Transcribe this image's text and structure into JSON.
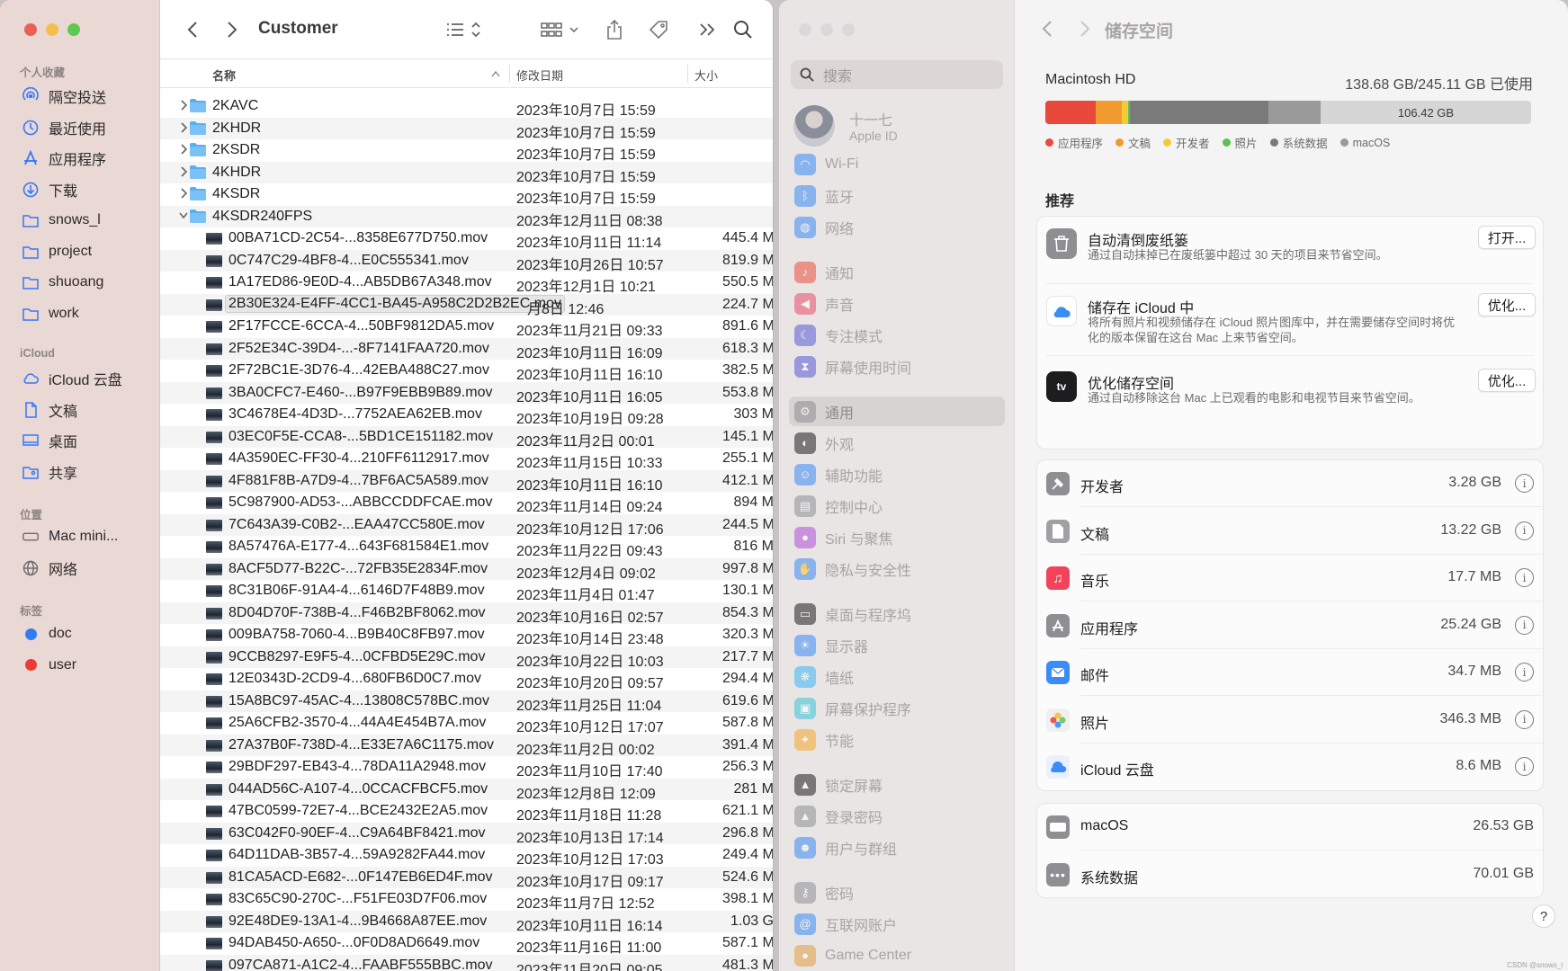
{
  "finder": {
    "title": "Customer",
    "sidebar": {
      "favorites_header": "个人收藏",
      "favorites": [
        {
          "label": "隔空投送",
          "icon": "airdrop-icon"
        },
        {
          "label": "最近使用",
          "icon": "clock-icon"
        },
        {
          "label": "应用程序",
          "icon": "applications-icon"
        },
        {
          "label": "下载",
          "icon": "download-icon"
        },
        {
          "label": "snows_l",
          "icon": "folder-icon"
        },
        {
          "label": "project",
          "icon": "folder-icon"
        },
        {
          "label": "shuoang",
          "icon": "folder-icon"
        },
        {
          "label": "work",
          "icon": "folder-icon"
        }
      ],
      "icloud_header": "iCloud",
      "icloud": [
        {
          "label": "iCloud 云盘",
          "icon": "cloud-icon"
        },
        {
          "label": "文稿",
          "icon": "document-icon"
        },
        {
          "label": "桌面",
          "icon": "desktop-icon"
        },
        {
          "label": "共享",
          "icon": "shared-folder-icon"
        }
      ],
      "locations_header": "位置",
      "locations": [
        {
          "label": "Mac mini...",
          "icon": "computer-icon"
        },
        {
          "label": "网络",
          "icon": "network-icon"
        }
      ],
      "tags_header": "标签",
      "tags": [
        {
          "label": "doc",
          "color": "#2f7cf6"
        },
        {
          "label": "user",
          "color": "#ec3b32"
        }
      ]
    },
    "columns": {
      "name": "名称",
      "date": "修改日期",
      "size": "大小"
    },
    "folders": [
      {
        "name": "2KAVC",
        "date": "2023年10月7日 15:59"
      },
      {
        "name": "2KHDR",
        "date": "2023年10月7日 15:59"
      },
      {
        "name": "2KSDR",
        "date": "2023年10月7日 15:59"
      },
      {
        "name": "4KHDR",
        "date": "2023年10月7日 15:59"
      },
      {
        "name": "4KSDR",
        "date": "2023年10月7日 15:59"
      },
      {
        "name": "4KSDR240FPS",
        "date": "2023年12月11日 08:38"
      }
    ],
    "files": [
      {
        "name": "00BA71CD-2C54-...8358E677D750.mov",
        "date": "2023年10月11日 11:14",
        "size": "445.4 M"
      },
      {
        "name": "0C747C29-4BF8-4...E0C555341.mov",
        "date": "2023年10月26日 10:57",
        "size": "819.9 M"
      },
      {
        "name": "1A17ED86-9E0D-4...AB5DB67A348.mov",
        "date": "2023年12月1日 10:21",
        "size": "550.5 M"
      },
      {
        "name": "2B30E324-E4FF-4CC1-BA45-A958C2D2B2EC.mov",
        "date": "月8日 12:46",
        "size": "224.7 M"
      },
      {
        "name": "2F17FCCE-6CCA-4...50BF9812DA5.mov",
        "date": "2023年11月21日 09:33",
        "size": "891.6 M"
      },
      {
        "name": "2F52E34C-39D4-...-8F7141FAA720.mov",
        "date": "2023年10月11日 16:09",
        "size": "618.3 M"
      },
      {
        "name": "2F72BC1E-3D76-4...42EBA488C27.mov",
        "date": "2023年10月11日 16:10",
        "size": "382.5 M"
      },
      {
        "name": "3BA0CFC7-E460-...B97F9EBB9B89.mov",
        "date": "2023年10月11日 16:05",
        "size": "553.8 M"
      },
      {
        "name": "3C4678E4-4D3D-...7752AEA62EB.mov",
        "date": "2023年10月19日 09:28",
        "size": "303 M"
      },
      {
        "name": "03EC0F5E-CCA8-...5BD1CE151182.mov",
        "date": "2023年11月2日 00:01",
        "size": "145.1 M"
      },
      {
        "name": "4A3590EC-FF30-4...210FF6112917.mov",
        "date": "2023年11月15日 10:33",
        "size": "255.1 M"
      },
      {
        "name": "4F881F8B-A7D9-4...7BF6AC5A589.mov",
        "date": "2023年10月11日 16:10",
        "size": "412.1 M"
      },
      {
        "name": "5C987900-AD53-...ABBCCDDFCAE.mov",
        "date": "2023年11月14日 09:24",
        "size": "894 M"
      },
      {
        "name": "7C643A39-C0B2-...EAA47CC580E.mov",
        "date": "2023年10月12日 17:06",
        "size": "244.5 M"
      },
      {
        "name": "8A57476A-E177-4...643F681584E1.mov",
        "date": "2023年11月22日 09:43",
        "size": "816 M"
      },
      {
        "name": "8ACF5D77-B22C-...72FB35E2834F.mov",
        "date": "2023年12月4日 09:02",
        "size": "997.8 M"
      },
      {
        "name": "8C31B06F-91A4-4...6146D7F48B9.mov",
        "date": "2023年11月4日 01:47",
        "size": "130.1 M"
      },
      {
        "name": "8D04D70F-738B-4...F46B2BF8062.mov",
        "date": "2023年10月16日 02:57",
        "size": "854.3 M"
      },
      {
        "name": "009BA758-7060-4...B9B40C8FB97.mov",
        "date": "2023年10月14日 23:48",
        "size": "320.3 M"
      },
      {
        "name": "9CCB8297-E9F5-4...0CFBD5E29C.mov",
        "date": "2023年10月22日 10:03",
        "size": "217.7 M"
      },
      {
        "name": "12E0343D-2CD9-4...680FB6D0C7.mov",
        "date": "2023年10月20日 09:57",
        "size": "294.4 M"
      },
      {
        "name": "15A8BC97-45AC-4...13808C578BC.mov",
        "date": "2023年11月25日 11:04",
        "size": "619.6 M"
      },
      {
        "name": "25A6CFB2-3570-4...44A4E454B7A.mov",
        "date": "2023年10月12日 17:07",
        "size": "587.8 M"
      },
      {
        "name": "27A37B0F-738D-4...E33E7A6C1175.mov",
        "date": "2023年11月2日 00:02",
        "size": "391.4 M"
      },
      {
        "name": "29BDF297-EB43-4...78DA11A2948.mov",
        "date": "2023年11月10日 17:40",
        "size": "256.3 M"
      },
      {
        "name": "044AD56C-A107-4...0CCACFBCF5.mov",
        "date": "2023年12月8日 12:09",
        "size": "281 M"
      },
      {
        "name": "47BC0599-72E7-4...BCE2432E2A5.mov",
        "date": "2023年11月18日 11:28",
        "size": "621.1 M"
      },
      {
        "name": "63C042F0-90EF-4...C9A64BF8421.mov",
        "date": "2023年10月13日 17:14",
        "size": "296.8 M"
      },
      {
        "name": "64D11DAB-3B57-4...59A9282FA44.mov",
        "date": "2023年10月12日 17:03",
        "size": "249.4 M"
      },
      {
        "name": "81CA5ACD-E682-...0F147EB6ED4F.mov",
        "date": "2023年10月17日 09:17",
        "size": "524.6 M"
      },
      {
        "name": "83C65C90-270C-...F51FE03D7F06.mov",
        "date": "2023年11月7日 12:52",
        "size": "398.1 M"
      },
      {
        "name": "92E48DE9-13A1-4...9B4668A87EE.mov",
        "date": "2023年10月11日 16:14",
        "size": "1.03 G"
      },
      {
        "name": "94DAB450-A650-...0F0D8AD6649.mov",
        "date": "2023年11月16日 11:00",
        "size": "587.1 M"
      },
      {
        "name": "097CA871-A1C2-4...FAABF555BBC.mov",
        "date": "2023年11月20日 09:05",
        "size": "481.3 M"
      }
    ]
  },
  "settings": {
    "search_placeholder": "搜索",
    "user": {
      "name": "十一七",
      "subtitle": "Apple ID"
    },
    "nav": [
      {
        "label": "Wi-Fi",
        "icon": "wifi-icon",
        "color": "#3b8cf6"
      },
      {
        "label": "蓝牙",
        "icon": "bluetooth-icon",
        "color": "#3b8cf6"
      },
      {
        "label": "网络",
        "icon": "globe-icon",
        "color": "#3b8cf6"
      },
      {
        "label": "通知",
        "icon": "bell-icon",
        "color": "#ec4d3d"
      },
      {
        "label": "声音",
        "icon": "speaker-icon",
        "color": "#ec4d6a"
      },
      {
        "label": "专注模式",
        "icon": "moon-icon",
        "color": "#5b5bd6"
      },
      {
        "label": "屏幕使用时间",
        "icon": "hourglass-icon",
        "color": "#5b5bd6"
      },
      {
        "label": "通用",
        "icon": "gear-icon",
        "color": "#8e8e93"
      },
      {
        "label": "外观",
        "icon": "appearance-icon",
        "color": "#1d1d1f"
      },
      {
        "label": "辅助功能",
        "icon": "accessibility-icon",
        "color": "#3b8cf6"
      },
      {
        "label": "控制中心",
        "icon": "control-center-icon",
        "color": "#8e8e93"
      },
      {
        "label": "Siri 与聚焦",
        "icon": "siri-icon",
        "color": "#b04fd6"
      },
      {
        "label": "隐私与安全性",
        "icon": "hand-icon",
        "color": "#3b8cf6"
      },
      {
        "label": "桌面与程序坞",
        "icon": "dock-icon",
        "color": "#1d1d1f"
      },
      {
        "label": "显示器",
        "icon": "sun-icon",
        "color": "#3b8cf6"
      },
      {
        "label": "墙纸",
        "icon": "wallpaper-icon",
        "color": "#3bb4f6"
      },
      {
        "label": "屏幕保护程序",
        "icon": "screensaver-icon",
        "color": "#3bc4d6"
      },
      {
        "label": "节能",
        "icon": "lightbulb-icon",
        "color": "#f4a62a"
      },
      {
        "label": "锁定屏幕",
        "icon": "lock-icon",
        "color": "#1d1d1f"
      },
      {
        "label": "登录密码",
        "icon": "lock-icon",
        "color": "#8e8e93"
      },
      {
        "label": "用户与群组",
        "icon": "users-icon",
        "color": "#3b8cf6"
      },
      {
        "label": "密码",
        "icon": "key-icon",
        "color": "#8e8e93"
      },
      {
        "label": "互联网账户",
        "icon": "at-icon",
        "color": "#3b8cf6"
      },
      {
        "label": "Game Center",
        "icon": "game-center-icon",
        "color": "#e0a040"
      }
    ],
    "title": "储存空间",
    "disk": {
      "name": "Macintosh HD",
      "used_text": "138.68 GB/245.11 GB 已使用",
      "free_label": "106.42 GB",
      "segments": [
        {
          "label": "应用程序",
          "color": "#e9483d",
          "fraction": 0.103
        },
        {
          "label": "文稿",
          "color": "#f19a30",
          "fraction": 0.054
        },
        {
          "label": "开发者",
          "color": "#f4c93a",
          "fraction": 0.013
        },
        {
          "label": "照片",
          "color": "#59c251",
          "fraction": 0.002
        },
        {
          "label": "系统数据",
          "color": "#7a7a7a",
          "fraction": 0.286
        },
        {
          "label": "macOS",
          "color": "#9a9a9a",
          "fraction": 0.108
        }
      ]
    },
    "recommendations_title": "推荐",
    "recommendations": [
      {
        "title": "自动清倒废纸篓",
        "desc": "通过自动抹掉已在废纸篓中超过 30 天的项目来节省空间。",
        "button": "打开...",
        "icon": "trash-icon"
      },
      {
        "title": "储存在 iCloud 中",
        "desc": "将所有照片和视频储存在 iCloud 照片图库中，并在需要储存空间时将优化的版本保留在这台 Mac 上来节省空间。",
        "button": "优化...",
        "icon": "icloud-icon"
      },
      {
        "title": "优化储存空间",
        "desc": "通过自动移除这台 Mac 上已观看的电影和电视节目来节省空间。",
        "button": "优化...",
        "icon": "apple-tv-icon"
      }
    ],
    "categories": [
      {
        "name": "开发者",
        "size": "3.28 GB",
        "icon": "hammer-icon",
        "color": "#8e8e93"
      },
      {
        "name": "文稿",
        "size": "13.22 GB",
        "icon": "document-icon",
        "color": "#a0a0a5"
      },
      {
        "name": "音乐",
        "size": "17.7 MB",
        "icon": "music-icon",
        "color": "#f2435a"
      },
      {
        "name": "应用程序",
        "size": "25.24 GB",
        "icon": "app-store-icon",
        "color": "#8e8e93"
      },
      {
        "name": "邮件",
        "size": "34.7 MB",
        "icon": "mail-icon",
        "color": "#3b8cf6"
      },
      {
        "name": "照片",
        "size": "346.3 MB",
        "icon": "photos-icon",
        "color": "#f0f0f0"
      },
      {
        "name": "iCloud 云盘",
        "size": "8.6 MB",
        "icon": "icloud-icon",
        "color": "#e8f1fd"
      }
    ],
    "system": [
      {
        "name": "macOS",
        "size": "26.53 GB",
        "icon": "macos-drive-icon",
        "color": "#8e8e93"
      },
      {
        "name": "系统数据",
        "size": "70.01 GB",
        "icon": "ellipsis-icon",
        "color": "#8e8e93"
      }
    ],
    "help": "?",
    "watermark": "CSDN @snows_l"
  }
}
